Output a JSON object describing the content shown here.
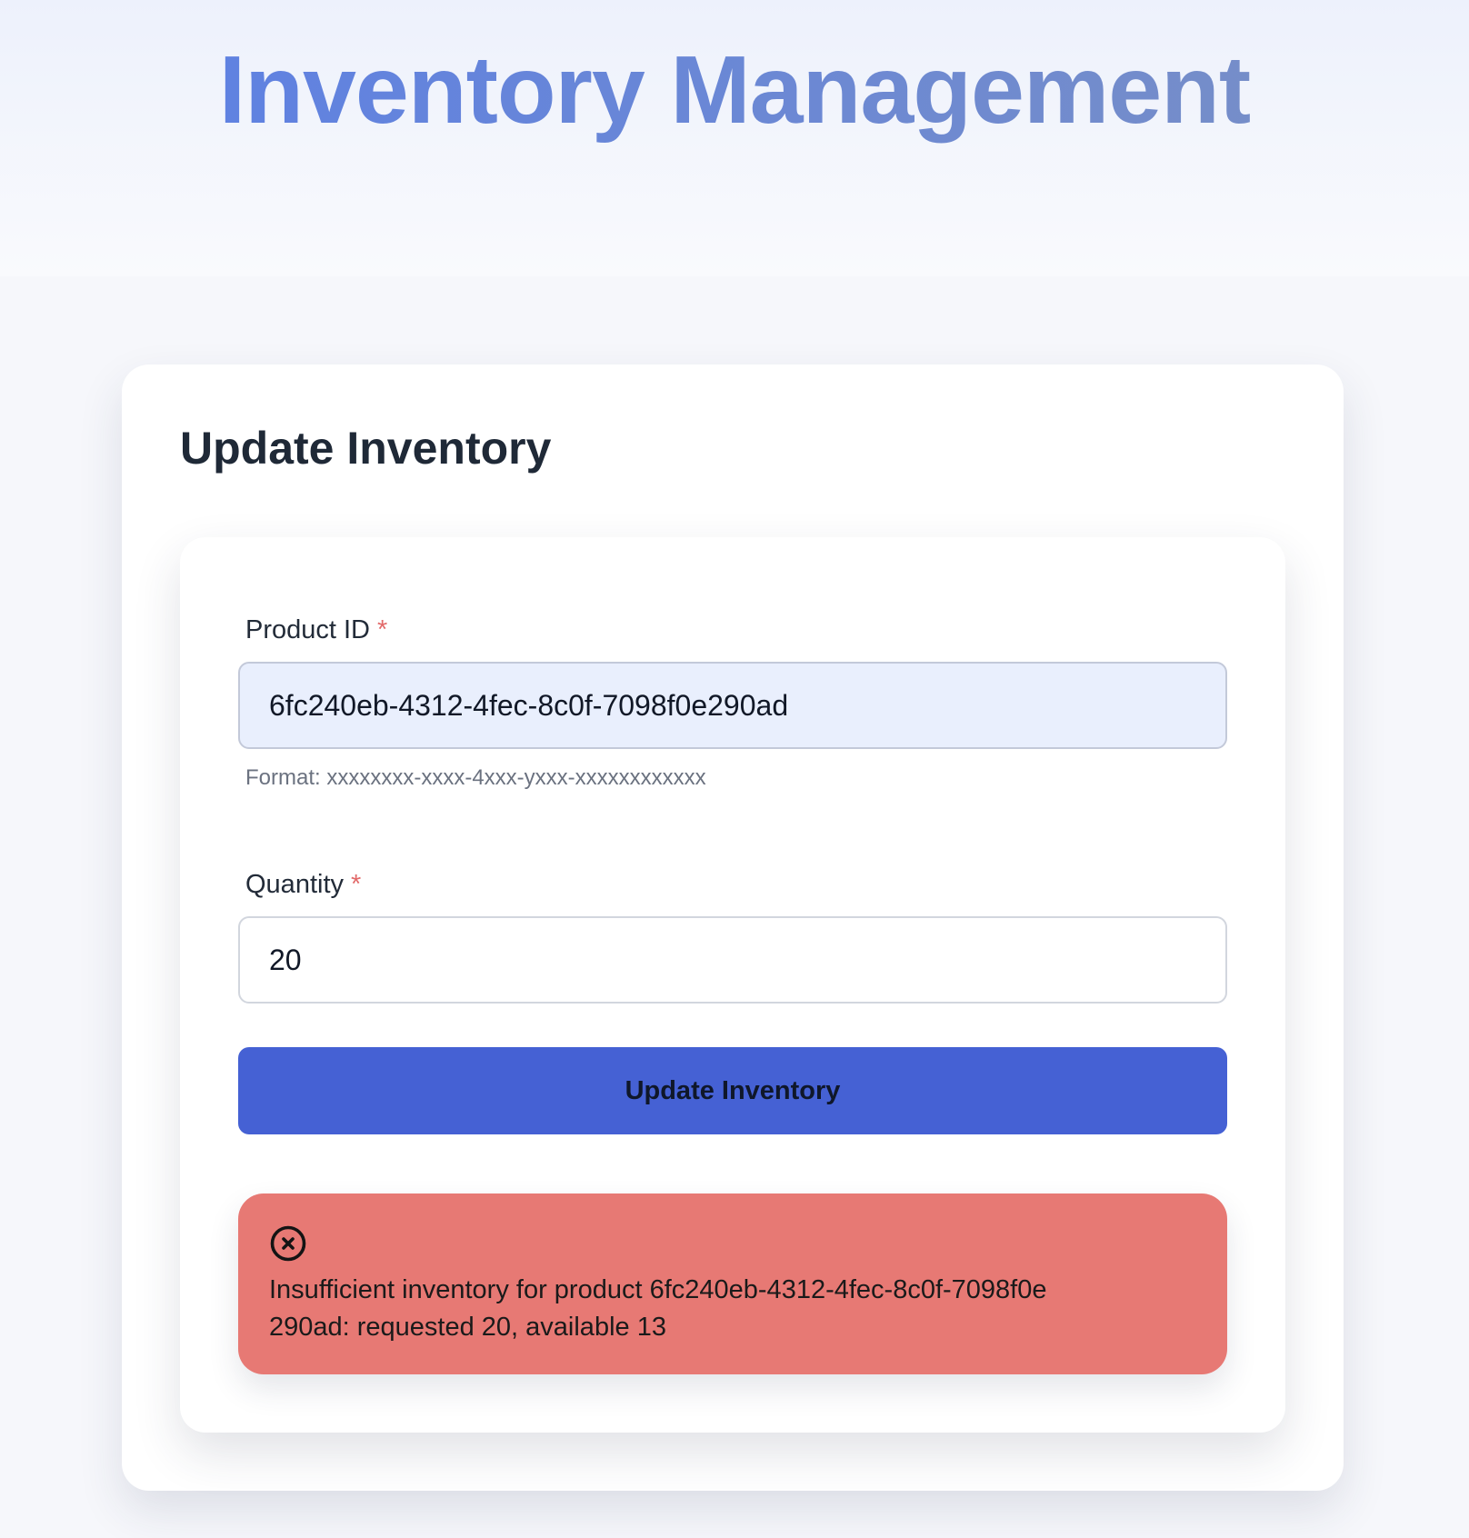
{
  "header": {
    "title": "Inventory Management"
  },
  "section": {
    "title": "Update Inventory"
  },
  "form": {
    "product_id": {
      "label": "Product ID",
      "required_marker": "*",
      "value": "6fc240eb-4312-4fec-8c0f-7098f0e290ad",
      "hint": "Format: xxxxxxxx-xxxx-4xxx-yxxx-xxxxxxxxxxxx"
    },
    "quantity": {
      "label": "Quantity",
      "required_marker": "*",
      "value": "20"
    },
    "submit_label": "Update Inventory"
  },
  "alert": {
    "type": "error",
    "icon": "x-circle-icon",
    "message": "Insufficient inventory for product 6fc240eb-4312-4fec-8c0f-7098f0e290ad: requested 20, available 13"
  },
  "colors": {
    "title_gradient_start": "#5b7fe6",
    "title_gradient_end": "#7a90c4",
    "primary_button": "#4561d4",
    "error_background": "#e77974",
    "required_star": "#e26a6a",
    "highlighted_input": "#e9effd"
  }
}
